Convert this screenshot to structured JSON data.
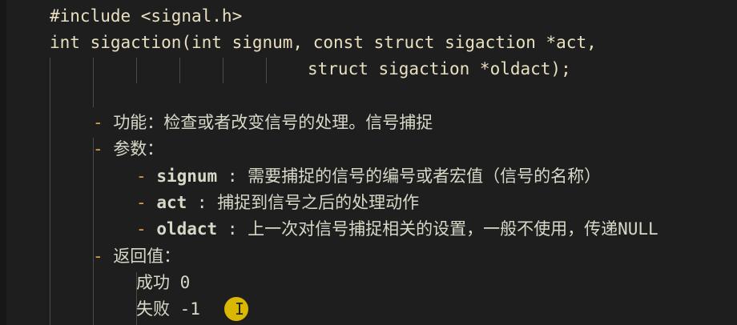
{
  "code": {
    "include_line": "#include <signal.h>",
    "signature_line_1": "int sigaction(int signum, const struct sigaction *act,",
    "signature_line_2": "struct sigaction *oldact);",
    "bullet_dash": "-",
    "function_label": "功能：检查或者改变信号的处理。信号捕捉",
    "params_label": "参数：",
    "param_signum_name": "signum",
    "param_signum_desc": " : 需要捕捉的信号的编号或者宏值（信号的名称）",
    "param_act_name": "act",
    "param_act_desc": " : 捕捉到信号之后的处理动作",
    "param_oldact_name": "oldact",
    "param_oldact_desc": " : 上一次对信号捕捉相关的设置，一般不使用，传递NULL",
    "return_label": "返回值：",
    "return_success": "成功 0",
    "return_fail": "失败 -1"
  },
  "colors": {
    "background": "#1e1e1e",
    "text": "#d8d8c8",
    "dash": "#d6a24a",
    "indent_guide": "#4a4a4a",
    "pointer_highlight": "#e5c000"
  },
  "icons": {
    "pointer": "i-beam-cursor-icon"
  }
}
